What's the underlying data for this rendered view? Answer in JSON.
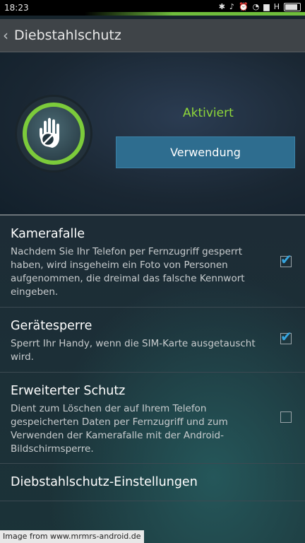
{
  "status_bar": {
    "time": "18:23",
    "network": "H",
    "icons": [
      "bluetooth-icon",
      "mute-icon",
      "alarm-icon",
      "wifi-icon",
      "signal-icon",
      "battery-icon"
    ]
  },
  "action_bar": {
    "title": "Diebstahlschutz"
  },
  "hero": {
    "status": "Aktiviert",
    "button_label": "Verwendung",
    "accent_color": "#7ccb3b",
    "button_color": "#2e6d8f"
  },
  "items": [
    {
      "title": "Kamerafalle",
      "description": "Nachdem Sie Ihr Telefon per Fernzugriff gesperrt haben, wird insgeheim ein Foto von Personen aufgenommen, die dreimal das falsche Kennwort eingeben.",
      "checked": true
    },
    {
      "title": "Gerätesperre",
      "description": "Sperrt Ihr Handy, wenn die SIM-Karte ausgetauscht wird.",
      "checked": true
    },
    {
      "title": "Erweiterter Schutz",
      "description": "Dient zum Löschen der auf Ihrem Telefon gespeicherten Daten per Fernzugriff und zum Verwenden der Kamerafalle mit der Android-Bildschirmsperre.",
      "checked": false
    },
    {
      "title": "Diebstahlschutz-Einstellungen"
    }
  ],
  "watermark": "Image from www.mrmrs-android.de",
  "check_glyph": "✔"
}
